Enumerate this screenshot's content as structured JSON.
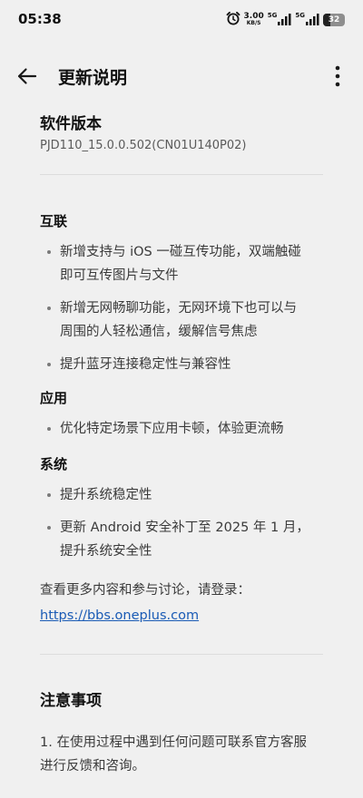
{
  "status_bar": {
    "time": "05:38",
    "net_speed_value": "3.00",
    "net_speed_unit": "KB/S",
    "sim1_tag": "5G",
    "sim2_tag": "5G",
    "battery_level": "32",
    "battery_fraction": 0.32,
    "icons": [
      "alarm-icon",
      "signal-icon",
      "signal-icon",
      "battery-icon"
    ]
  },
  "header": {
    "title": "更新说明",
    "back_icon": "arrow-left-icon",
    "more_icon": "more-vertical-icon"
  },
  "version": {
    "label": "软件版本",
    "number": "PJD110_15.0.0.502(CN01U140P02)"
  },
  "sections": [
    {
      "title": "互联",
      "items": [
        [
          "新增支持与 iOS 一碰互传功能，双端触碰",
          "即可互传图片与文件"
        ],
        [
          "新增无网畅聊功能，无网环境下也可以与",
          "周围的人轻松通信，缓解信号焦虑"
        ],
        [
          "提升蓝牙连接稳定性与兼容性"
        ]
      ]
    },
    {
      "title": "应用",
      "items": [
        [
          "优化特定场景下应用卡顿，体验更流畅"
        ]
      ]
    },
    {
      "title": "系统",
      "items": [
        [
          "提升系统稳定性"
        ],
        [
          "更新 Android 安全补丁至 2025 年 1 月，",
          "提升系统安全性"
        ]
      ]
    }
  ],
  "more_info": {
    "text": "查看更多内容和参与讨论，请登录：",
    "link": "https://bbs.oneplus.com"
  },
  "notice": {
    "title": "注意事项",
    "item_1_line_1": "1. 在使用过程中遇到任何问题可联系官方客服",
    "item_1_line_2": "进行反馈和咨询。"
  },
  "colors": {
    "background": "#f0f0f0",
    "link": "#1a5bb5"
  }
}
